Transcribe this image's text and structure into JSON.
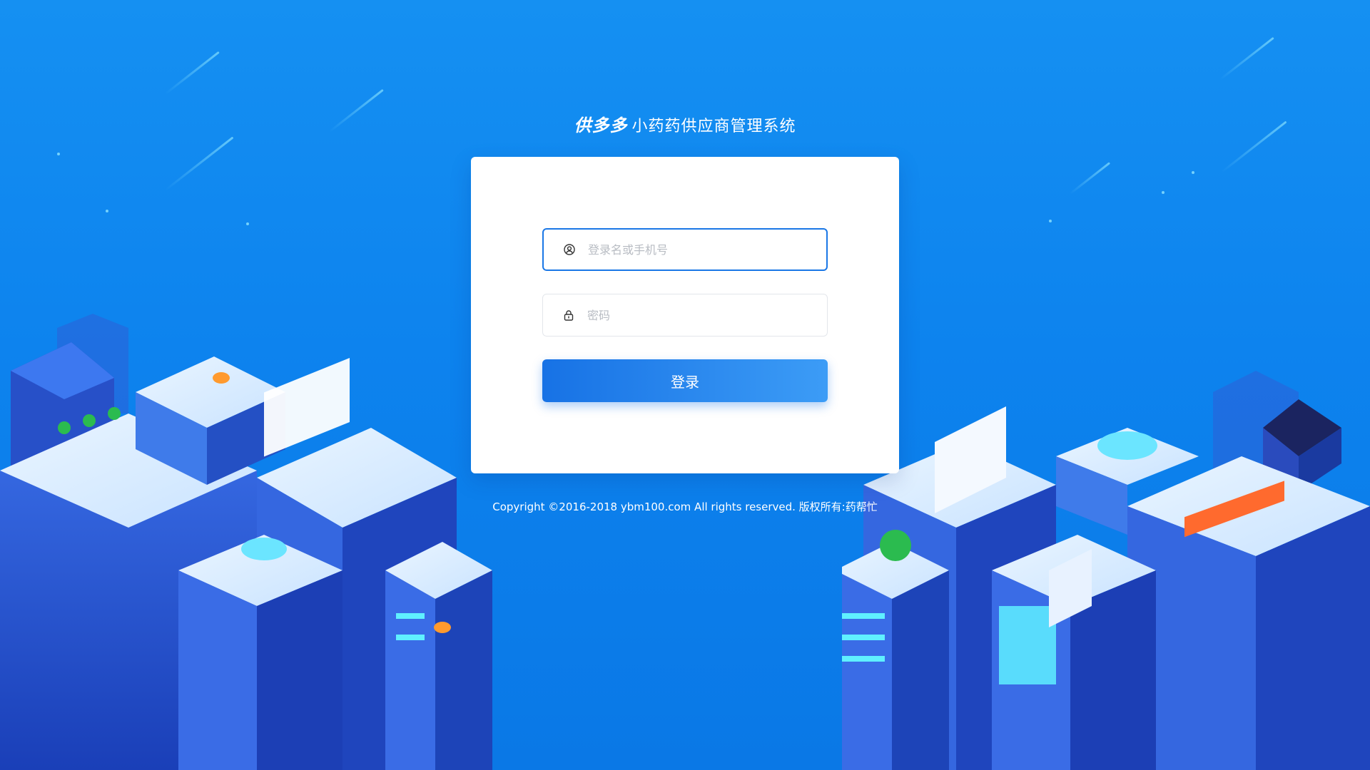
{
  "header": {
    "logo_text": "供多多",
    "title": "小药药供应商管理系统"
  },
  "form": {
    "username": {
      "placeholder": "登录名或手机号",
      "value": "",
      "icon": "user-icon"
    },
    "password": {
      "placeholder": "密码",
      "value": "",
      "icon": "lock-icon"
    },
    "submit_label": "登录"
  },
  "footer": {
    "copyright": "Copyright ©2016-2018 ybm100.com All rights reserved. 版权所有:药帮忙"
  },
  "theme": {
    "background": "#0d83ee",
    "button_start": "#1772e5",
    "button_end": "#3c9cf6",
    "focus_border": "#1a77e6"
  }
}
